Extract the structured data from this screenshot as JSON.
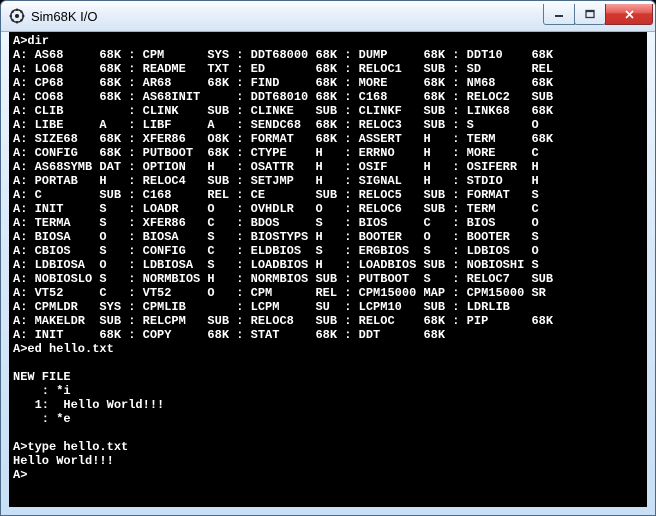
{
  "window": {
    "title": "Sim68K I/O"
  },
  "buttons": {
    "min": "minimize",
    "max": "maximize",
    "close": "close"
  },
  "prompt_dir": "A>dir",
  "dir_rows": [
    [
      "A:",
      "AS68",
      "68K",
      ":",
      "CPM",
      "SYS",
      ":",
      "DDT68000",
      "68K",
      ":",
      "DUMP",
      "68K",
      ":",
      "DDT10",
      "68K"
    ],
    [
      "A:",
      "LO68",
      "68K",
      ":",
      "README",
      "TXT",
      ":",
      "ED",
      "68K",
      ":",
      "RELOC1",
      "SUB",
      ":",
      "SD",
      "REL"
    ],
    [
      "A:",
      "CP68",
      "68K",
      ":",
      "AR68",
      "68K",
      ":",
      "FIND",
      "68K",
      ":",
      "MORE",
      "68K",
      ":",
      "NM68",
      "68K"
    ],
    [
      "A:",
      "CO68",
      "68K",
      ":",
      "AS68INIT",
      "",
      ":",
      "DDT68010",
      "68K",
      ":",
      "C168",
      "68K",
      ":",
      "RELOC2",
      "SUB"
    ],
    [
      "A:",
      "CLIB",
      "",
      ":",
      "CLINK",
      "SUB",
      ":",
      "CLINKE",
      "SUB",
      ":",
      "CLINKF",
      "SUB",
      ":",
      "LINK68",
      "68K"
    ],
    [
      "A:",
      "LIBE",
      "A",
      ":",
      "LIBF",
      "A",
      ":",
      "SENDC68",
      "68K",
      ":",
      "RELOC3",
      "SUB",
      ":",
      "S",
      "O"
    ],
    [
      "A:",
      "SIZE68",
      "68K",
      ":",
      "XFER86",
      "O8K",
      ":",
      "FORMAT",
      "68K",
      ":",
      "ASSERT",
      "H",
      ":",
      "TERM",
      "68K"
    ],
    [
      "A:",
      "CONFIG",
      "68K",
      ":",
      "PUTBOOT",
      "68K",
      ":",
      "CTYPE",
      "H",
      ":",
      "ERRNO",
      "H",
      ":",
      "MORE",
      "C"
    ],
    [
      "A:",
      "AS68SYMB",
      "DAT",
      ":",
      "OPTION",
      "H",
      ":",
      "OSATTR",
      "H",
      ":",
      "OSIF",
      "H",
      ":",
      "OSIFERR",
      "H"
    ],
    [
      "A:",
      "PORTAB",
      "H",
      ":",
      "RELOC4",
      "SUB",
      ":",
      "SETJMP",
      "H",
      ":",
      "SIGNAL",
      "H",
      ":",
      "STDIO",
      "H"
    ],
    [
      "A:",
      "C",
      "SUB",
      ":",
      "C168",
      "REL",
      ":",
      "CE",
      "SUB",
      ":",
      "RELOC5",
      "SUB",
      ":",
      "FORMAT",
      "S"
    ],
    [
      "A:",
      "INIT",
      "S",
      ":",
      "LOADR",
      "O",
      ":",
      "OVHDLR",
      "O",
      ":",
      "RELOC6",
      "SUB",
      ":",
      "TERM",
      "C"
    ],
    [
      "A:",
      "TERMA",
      "S",
      ":",
      "XFER86",
      "C",
      ":",
      "BDOS",
      "S",
      ":",
      "BIOS",
      "C",
      ":",
      "BIOS",
      "O"
    ],
    [
      "A:",
      "BIOSA",
      "O",
      ":",
      "BIOSA",
      "S",
      ":",
      "BIOSTYPS",
      "H",
      ":",
      "BOOTER",
      "O",
      ":",
      "BOOTER",
      "S"
    ],
    [
      "A:",
      "CBIOS",
      "S",
      ":",
      "CONFIG",
      "C",
      ":",
      "ELDBIOS",
      "S",
      ":",
      "ERGBIOS",
      "S",
      ":",
      "LDBIOS",
      "O"
    ],
    [
      "A:",
      "LDBIOSA",
      "O",
      ":",
      "LDBIOSA",
      "S",
      ":",
      "LOADBIOS",
      "H",
      ":",
      "LOADBIOS",
      "SUB",
      ":",
      "NOBIOSHI",
      "S"
    ],
    [
      "A:",
      "NOBIOSLO",
      "S",
      ":",
      "NORMBIOS",
      "H",
      ":",
      "NORMBIOS",
      "SUB",
      ":",
      "PUTBOOT",
      "S",
      ":",
      "RELOC7",
      "SUB"
    ],
    [
      "A:",
      "VT52",
      "C",
      ":",
      "VT52",
      "O",
      ":",
      "CPM",
      "REL",
      ":",
      "CPM15000",
      "MAP",
      ":",
      "CPM15000",
      "SR"
    ],
    [
      "A:",
      "CPMLDR",
      "SYS",
      ":",
      "CPMLIB",
      "",
      ":",
      "LCPM",
      "SU",
      ":",
      "LCPM10",
      "SUB",
      ":",
      "LDRLIB",
      ""
    ],
    [
      "A:",
      "MAKELDR",
      "SUB",
      ":",
      "RELCPM",
      "SUB",
      ":",
      "RELOC8",
      "SUB",
      ":",
      "RELOC",
      "68K",
      ":",
      "PIP",
      "68K"
    ],
    [
      "A:",
      "INIT",
      "68K",
      ":",
      "COPY",
      "68K",
      ":",
      "STAT",
      "68K",
      ":",
      "DDT",
      "68K",
      "",
      "",
      ""
    ]
  ],
  "widths": [
    3,
    9,
    4,
    2,
    9,
    4,
    2,
    9,
    4,
    2,
    9,
    4,
    2,
    9,
    3
  ],
  "session": [
    "A>ed hello.txt",
    "",
    "NEW FILE",
    "    : *i",
    "   1:  Hello World!!!",
    "    : *e",
    "",
    "A>type hello.txt",
    "Hello World!!!",
    "A>"
  ]
}
